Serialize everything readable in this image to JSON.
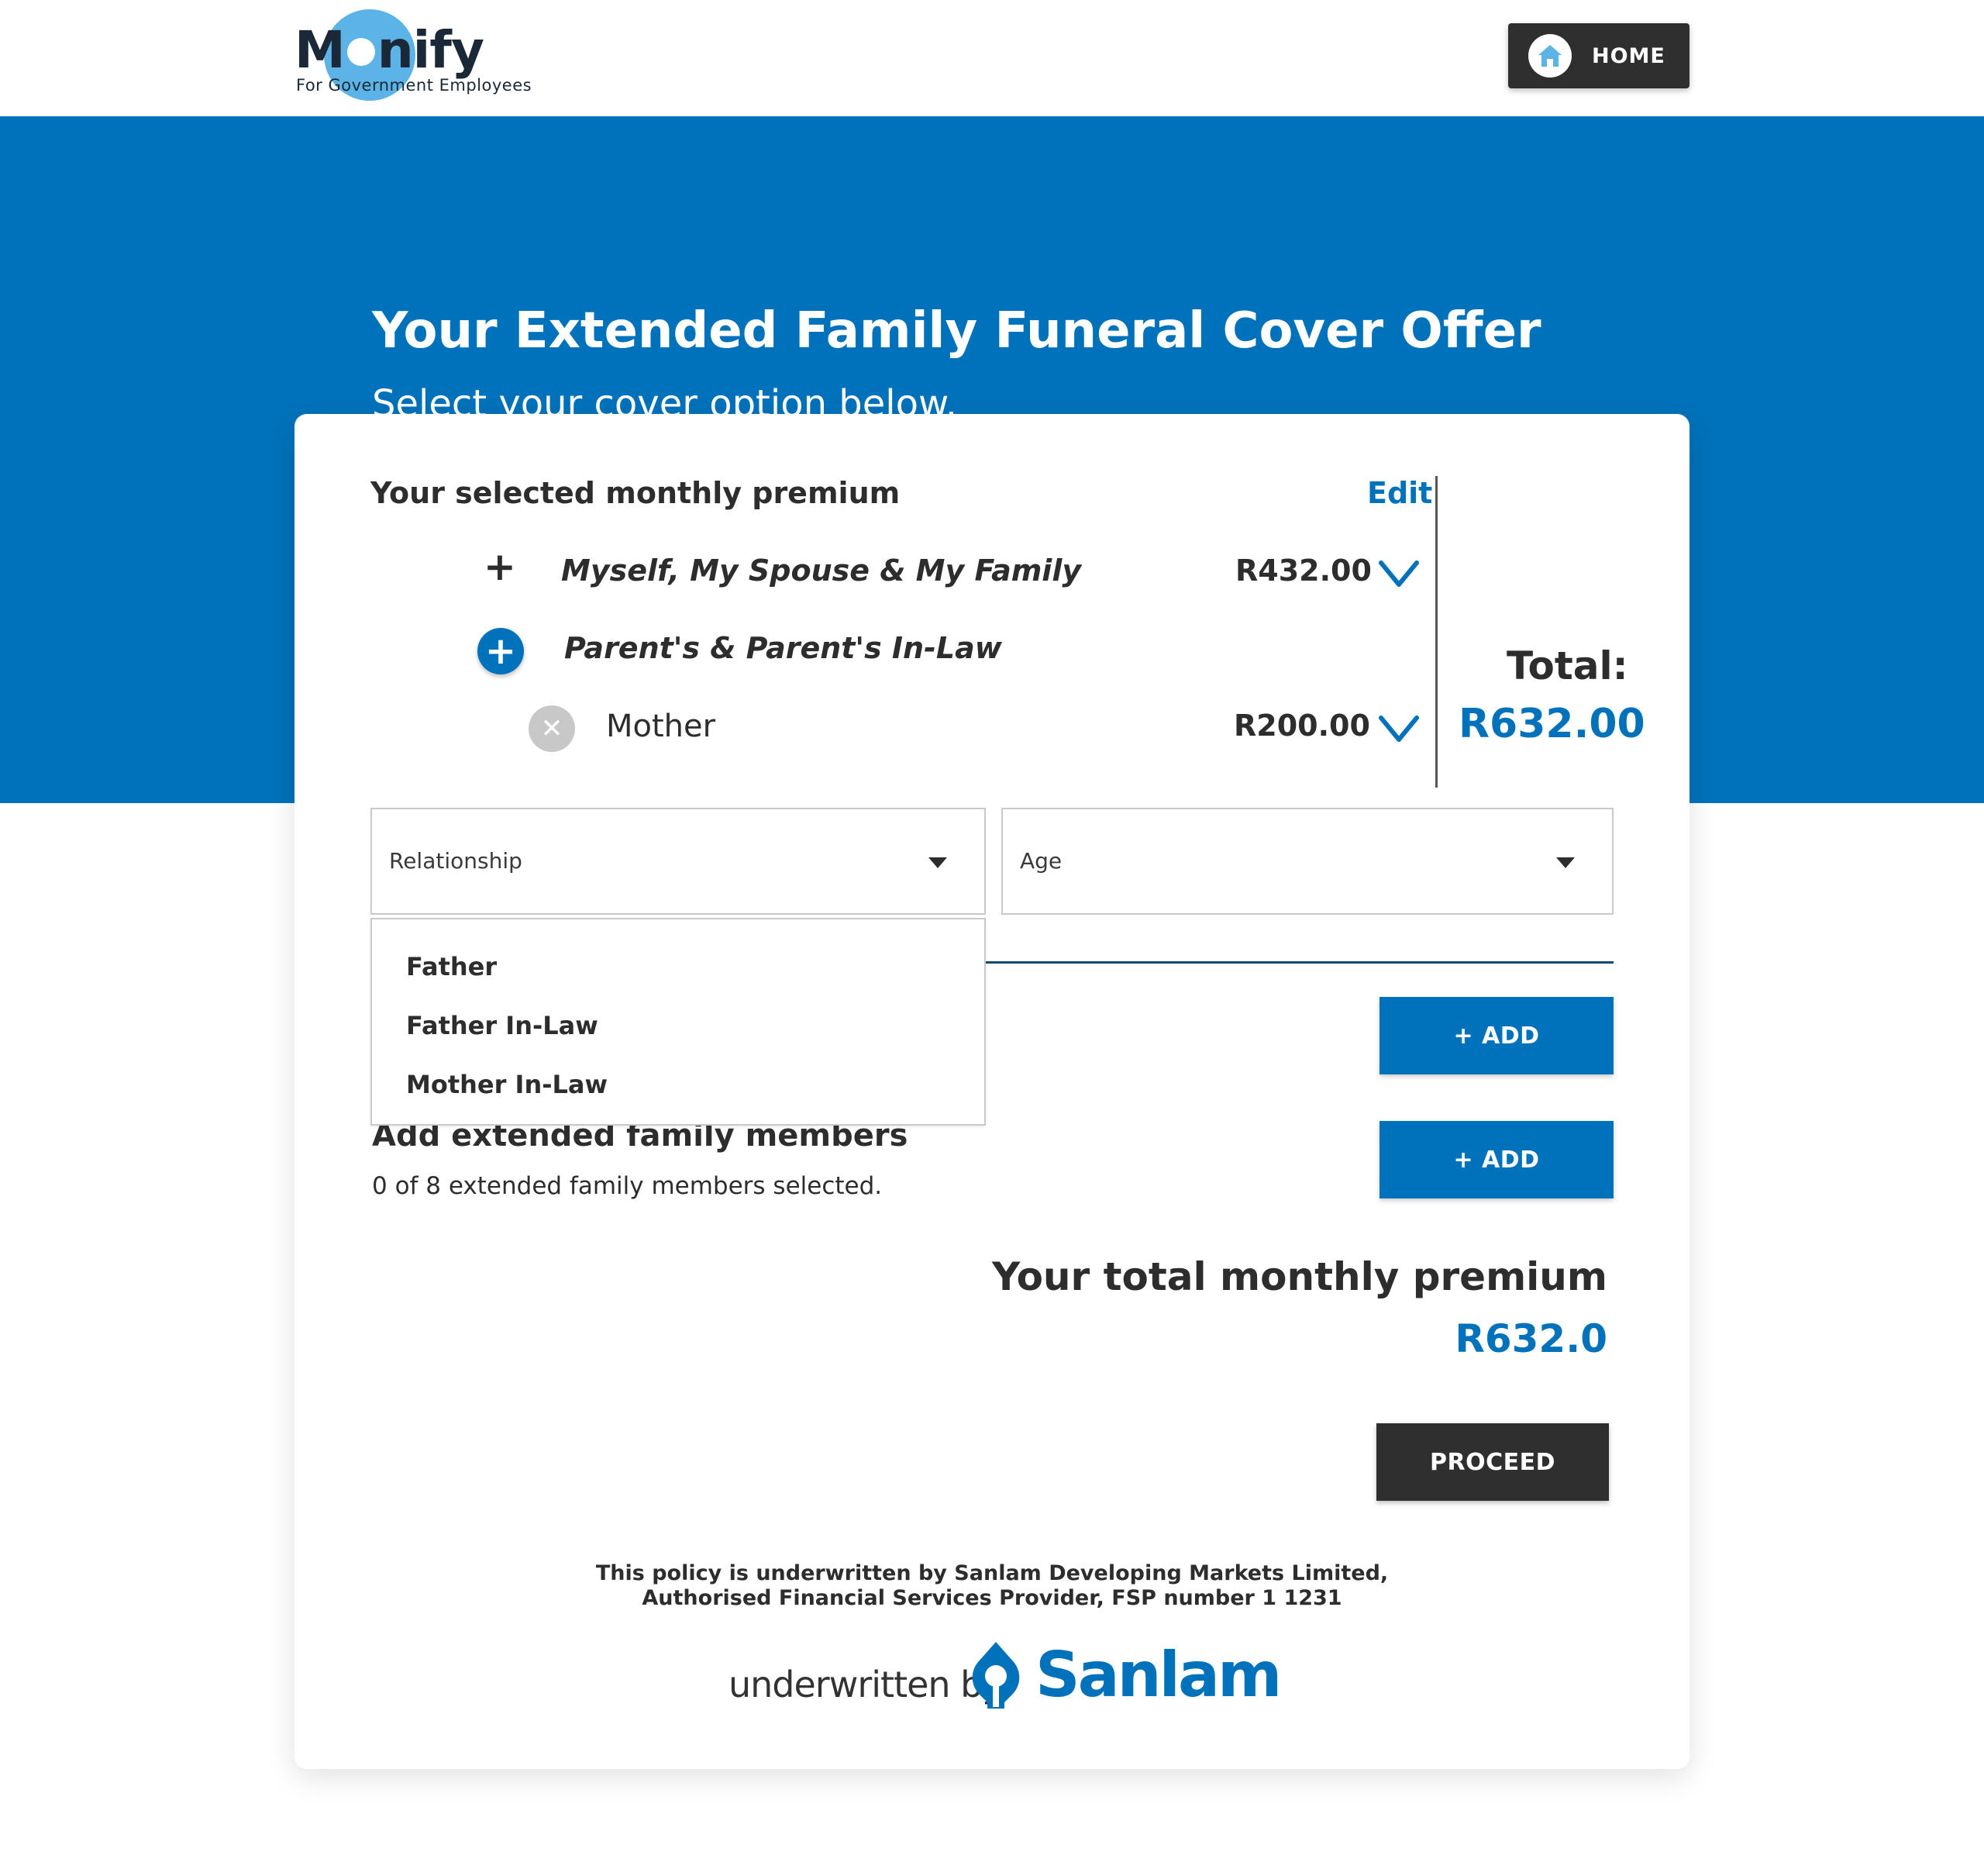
{
  "header": {
    "logo": {
      "text_before": "M",
      "text_after": "nify",
      "tagline": "For Government Employees"
    },
    "home_button": {
      "label": "HOME",
      "icon": "home-icon"
    }
  },
  "hero": {
    "title": "Your Extended Family Funeral Cover Offer",
    "subtitle": "Select your cover option below."
  },
  "summary": {
    "title": "Your selected monthly premium",
    "edit_label": "Edit",
    "rows": [
      {
        "icon": "plus-icon",
        "label": "Myself, My Spouse & My Family",
        "price": "R432.00"
      },
      {
        "icon": "plus-circle-icon",
        "label": "Parent's & Parent's In-Law"
      },
      {
        "icon": "remove-circle-icon",
        "label": "Mother",
        "price": "R200.00"
      }
    ],
    "total_label": "Total:",
    "total_value": "R632.00"
  },
  "form": {
    "relationship_select": {
      "placeholder": "Relationship"
    },
    "age_select": {
      "placeholder": "Age"
    },
    "relationship_options": [
      "Father",
      "Father In-Law",
      "Mother In-Law"
    ],
    "add_button_label": "+ ADD"
  },
  "extended": {
    "title": "Add extended family members",
    "subtitle": "0 of 8 extended family members selected.",
    "add_button_label": "+ ADD"
  },
  "premium": {
    "label": "Your total monthly premium",
    "value": "R632.0"
  },
  "proceed_label": "PROCEED",
  "footer": {
    "disclaimer_line1": "This policy is underwritten by Sanlam Developing Markets Limited,",
    "disclaimer_line2": "Authorised Financial Services Provider, FSP number 1 1231",
    "underwritten_by": "underwritten by",
    "brand": "Sanlam"
  },
  "colors": {
    "brand_blue": "#0072bb",
    "dark_button": "#2f2f2f",
    "logo_circle": "#5bb3e6"
  }
}
